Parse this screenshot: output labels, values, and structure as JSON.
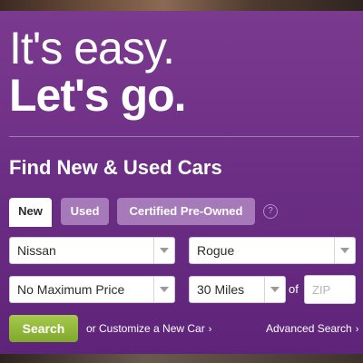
{
  "hero": {
    "line1": "It's easy.",
    "line2": "Let's go."
  },
  "finder": {
    "title": "Find New & Used Cars",
    "tabs": [
      {
        "label": "New",
        "selected": true
      },
      {
        "label": "Used",
        "selected": false
      },
      {
        "label": "Certified Pre-Owned",
        "selected": false
      }
    ],
    "help_icon_glyph": "?",
    "make": {
      "value": "Nissan"
    },
    "model": {
      "value": "Rogue"
    },
    "price": {
      "value": "No Maximum Price"
    },
    "distance": {
      "value": "30 Miles"
    },
    "of_label": "of",
    "zip": {
      "value": "",
      "placeholder": "ZIP"
    },
    "search_label": "Search",
    "customize_link": "or Customize a New Car",
    "advanced_link": "Advanced Search",
    "link_chevron": "›"
  },
  "icons": {
    "help": "help-circle-icon",
    "dropdown": "chevron-down-icon"
  },
  "colors": {
    "panel_purple": "#6d2f86",
    "tab_inactive": "#a67ab8",
    "search_green": "#8cb33a",
    "text_white": "#ffffff"
  }
}
